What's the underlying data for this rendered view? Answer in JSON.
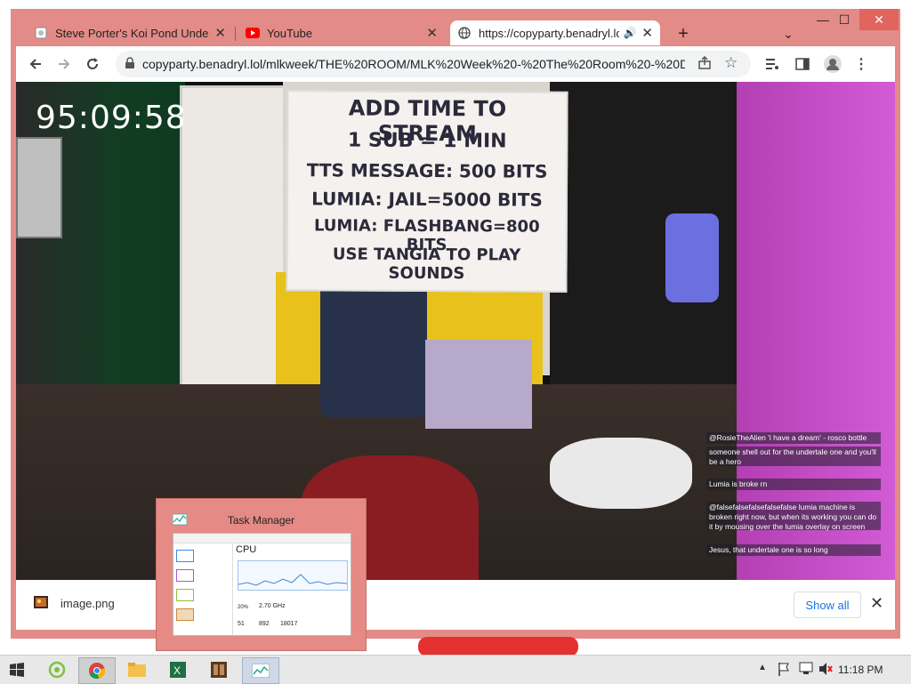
{
  "browser": {
    "tabs": [
      {
        "title": "Steve Porter's Koi Pond Underwa",
        "icon": "page-icon"
      },
      {
        "title": "YouTube",
        "icon": "youtube-icon"
      },
      {
        "title": "https://copyparty.benadryl.lo",
        "icon": "globe-icon"
      }
    ],
    "url": "copyparty.benadryl.lol/mlkweek/THE%20ROOM/MLK%20Week%20-%20The%20Room%20-%20Day%..."
  },
  "stream": {
    "timer": "95:09:58",
    "whiteboard": [
      "ADD TIME TO STREAM",
      "1 SUB = 1 MIN",
      "TTS MESSAGE: 500 BITS",
      "LUMIA: JAIL=5000 BITS",
      "LUMIA: FLASHBANG=800 BITS",
      "USE TANGIA TO PLAY SOUNDS"
    ],
    "chat": [
      {
        "text": "@RosieTheAlien 'i have a dream' - rosco bottle"
      },
      {
        "text": "someone shell out for the undertale one and you'll be a hero"
      },
      {
        "text": "Lumia is broke rn"
      },
      {
        "text": "@falsefalsefalsefalsefalse lumia machine is broken right now, but when its working you can do it by mousing over the lumia overlay on screen"
      },
      {
        "text": "Jesus, that undertale one is so long"
      }
    ]
  },
  "download_bar": {
    "file": "image.png",
    "show_all": "Show all"
  },
  "task_manager_preview": {
    "title": "Task Manager",
    "cpu_label": "CPU",
    "speed": "2.70 GHz",
    "utilization": "20%",
    "processes": "51",
    "threads": "892",
    "handles": "18017"
  },
  "taskbar": {
    "time": "11:18 PM"
  }
}
